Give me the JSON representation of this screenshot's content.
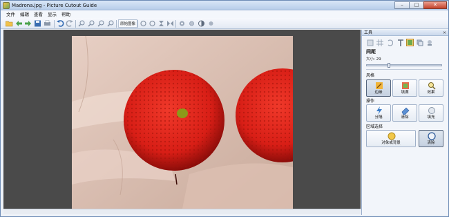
{
  "window": {
    "title": "Madrona.jpg - Picture Cutout Guide",
    "minimize": "–",
    "maximize": "□",
    "close": "✕"
  },
  "menu": [
    "文件",
    "编辑",
    "查看",
    "显示",
    "帮助"
  ],
  "toolbar": {
    "original_image_label": "原始图像"
  },
  "panel": {
    "title": "工具",
    "close": "×",
    "section_spacing": "间距",
    "size_text": "大小: 29",
    "size_value": 29,
    "section_style": "风格",
    "style_buttons": [
      {
        "label": "边缘",
        "icon": "edge-pencil-icon",
        "selected": true
      },
      {
        "label": "填满",
        "icon": "fill-icon",
        "selected": false
      },
      {
        "label": "效果",
        "icon": "effect-magnifier-icon",
        "selected": false
      }
    ],
    "section_operate": "操作",
    "operate_buttons": [
      {
        "label": "分隔",
        "icon": "split-lightning-icon"
      },
      {
        "label": "清除",
        "icon": "eraser-icon"
      },
      {
        "label": "填充",
        "icon": "fill-circle-icon"
      }
    ],
    "section_region": "区域选择",
    "region_buttons": [
      {
        "label": "对象或背景",
        "icon": "object-background-icon",
        "selected": false
      },
      {
        "label": "清除",
        "icon": "clear-region-icon",
        "selected": true
      }
    ]
  }
}
